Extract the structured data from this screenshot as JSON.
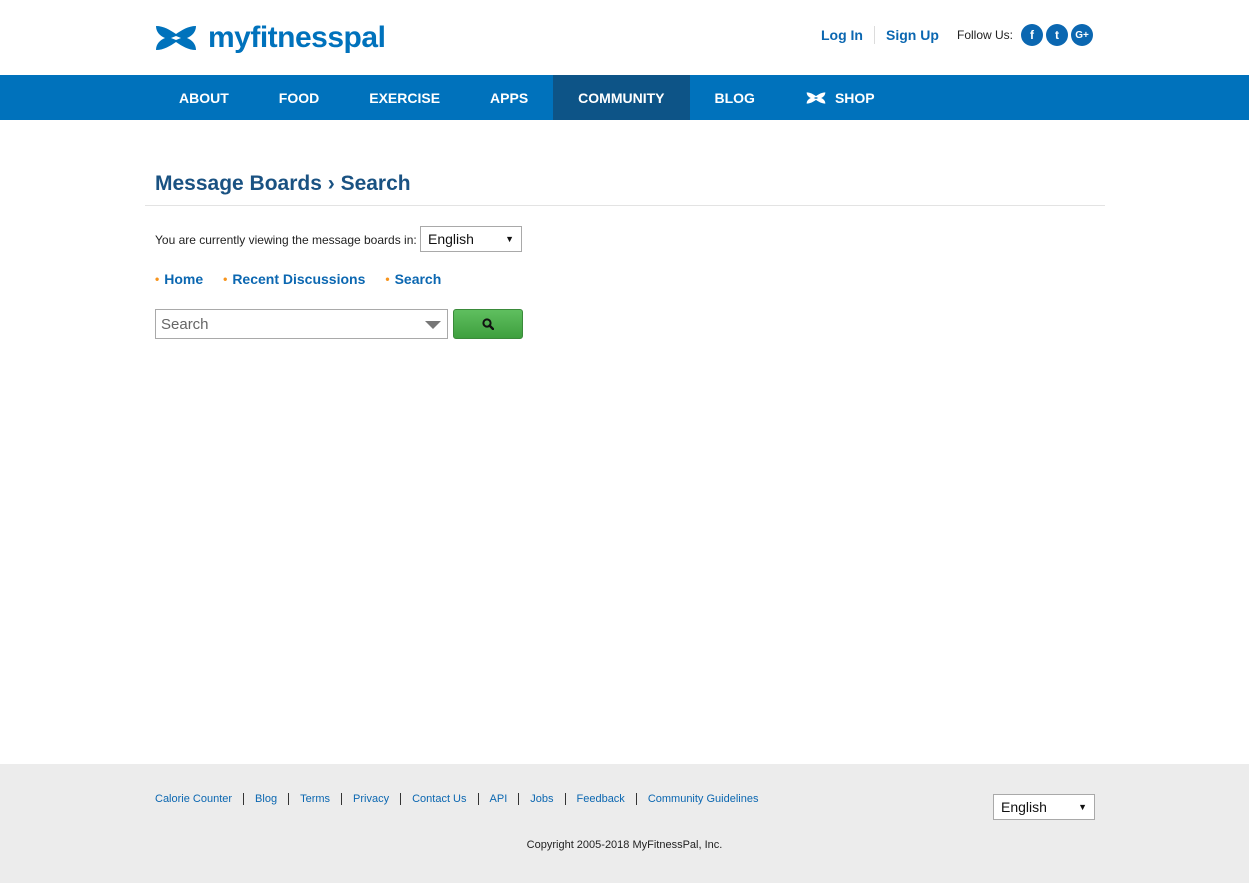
{
  "header": {
    "logo_text": "myfitnesspal",
    "login_label": "Log In",
    "signup_label": "Sign Up",
    "follow_label": "Follow Us:",
    "social": [
      {
        "icon": "facebook-icon",
        "glyph": "f"
      },
      {
        "icon": "twitter-icon",
        "glyph": "t"
      },
      {
        "icon": "google-plus-icon",
        "glyph": "G+"
      }
    ]
  },
  "nav": {
    "items": [
      "ABOUT",
      "FOOD",
      "EXERCISE",
      "APPS",
      "COMMUNITY",
      "BLOG",
      "SHOP"
    ],
    "active": "COMMUNITY"
  },
  "main": {
    "title": "Message Boards › Search",
    "viewing_label": "You are currently viewing the message boards in:",
    "language_selected": "English",
    "links": [
      "Home",
      "Recent Discussions",
      "Search"
    ],
    "search_placeholder": "Search"
  },
  "footer": {
    "links": [
      "Calorie Counter",
      "Blog",
      "Terms",
      "Privacy",
      "Contact Us",
      "API",
      "Jobs",
      "Feedback",
      "Community Guidelines"
    ],
    "language_selected": "English",
    "copyright": "Copyright 2005-2018 MyFitnessPal, Inc."
  },
  "colors": {
    "brand_blue": "#0072bc",
    "nav_active": "#0d5487",
    "title_blue": "#1a5282",
    "bullet_orange": "#f7941d",
    "search_green": "#4caf50"
  }
}
